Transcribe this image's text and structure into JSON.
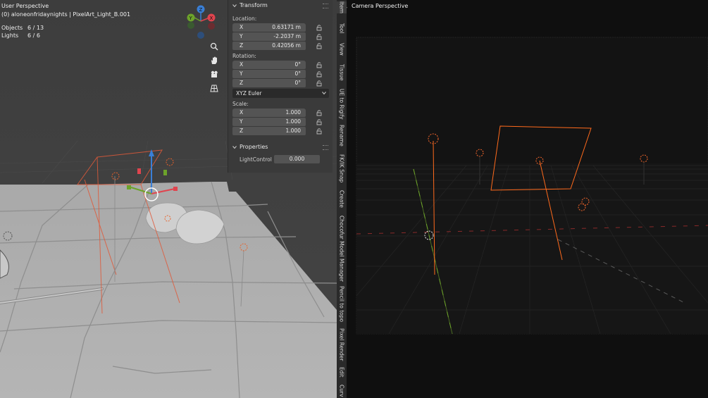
{
  "left_viewport": {
    "title": "User Perspective",
    "subtitle": "(0) aloneonfridaynights | PixelArt_Light_B.001",
    "stats": [
      {
        "label": "Objects",
        "value": "6 / 13"
      },
      {
        "label": "Lights",
        "value": "6 / 6"
      }
    ],
    "gizmo_axes": [
      "Z",
      "Y",
      "X"
    ],
    "nav_icons": [
      "zoom-icon",
      "hand-pan-icon",
      "camera-view-icon",
      "grid-perspective-icon"
    ]
  },
  "transform_panel": {
    "header": "Transform",
    "location_label": "Location:",
    "location": [
      {
        "axis": "X",
        "value": "0.63171 m"
      },
      {
        "axis": "Y",
        "value": "-2.2037 m"
      },
      {
        "axis": "Z",
        "value": "0.42056 m"
      }
    ],
    "rotation_label": "Rotation:",
    "rotation": [
      {
        "axis": "X",
        "value": "0°"
      },
      {
        "axis": "Y",
        "value": "0°"
      },
      {
        "axis": "Z",
        "value": "0°"
      }
    ],
    "rotation_mode": "XYZ Euler",
    "scale_label": "Scale:",
    "scale": [
      {
        "axis": "X",
        "value": "1.000"
      },
      {
        "axis": "Y",
        "value": "1.000"
      },
      {
        "axis": "Z",
        "value": "1.000"
      }
    ]
  },
  "properties_panel": {
    "header": "Properties",
    "items": [
      {
        "label": "LightControl",
        "value": "0.000"
      }
    ]
  },
  "sidebar_tabs": [
    "Item",
    "Tool",
    "View",
    "Tissue",
    "UE to Rigify",
    "Rename",
    "FK/IK Snap",
    "Create",
    "Chocofur Model Manager",
    "Pencil to topo",
    "Pixel Render",
    "Edit",
    "Curv"
  ],
  "active_tab": "Item",
  "right_viewport": {
    "title": "Camera Perspective"
  },
  "colors": {
    "light_orange": "#e8622a",
    "selection_orange": "#ff6a1c",
    "axis_x": "#e0444e",
    "axis_y": "#6da32a",
    "axis_z": "#3a7fd6"
  }
}
